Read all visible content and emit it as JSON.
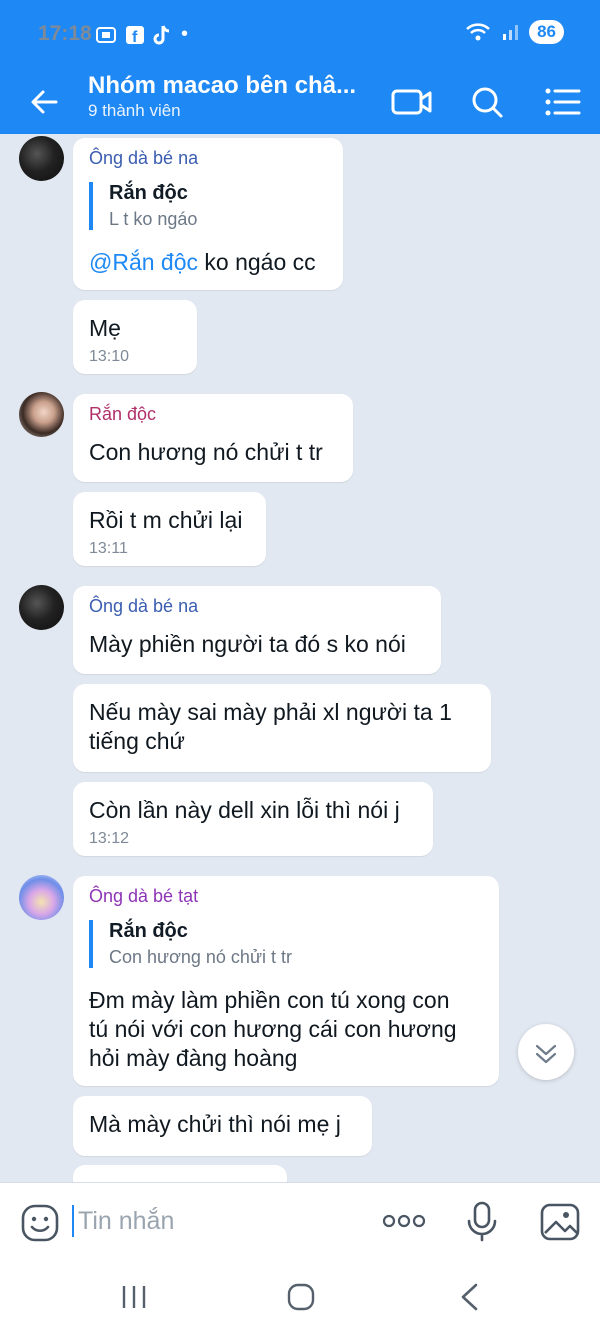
{
  "status": {
    "time": "17:18",
    "battery": "86"
  },
  "header": {
    "title": "Nhóm macao bên châ...",
    "subtitle": "9 thành viên"
  },
  "messages": {
    "m1": {
      "sender": "Ông dà bé na",
      "quote_name": "Rắn độc",
      "quote_text": "L t ko ngáo",
      "mention": "@Rắn độc",
      "text": " ko ngáo cc"
    },
    "m2": {
      "text": "Mẹ",
      "time": "13:10"
    },
    "m3": {
      "sender": "Rắn độc",
      "text": "Con hương nó chửi t tr"
    },
    "m4": {
      "text": "Rồi t m chửi lại",
      "time": "13:11"
    },
    "m5": {
      "sender": "Ông dà bé na",
      "text": "Mày phiền người ta đó s ko nói"
    },
    "m6": {
      "line1": "Nếu mày sai mày phải xl người ta 1",
      "line2": "tiếng chứ"
    },
    "m7": {
      "text": "Còn lần này dell xin lỗi thì nói j",
      "time": "13:12"
    },
    "m8": {
      "sender": "Ông dà bé tạt",
      "quote_name": "Rắn độc",
      "quote_text": "Con hương nó chửi t tr",
      "line1": "Đm mày làm phiền con tú xong con",
      "line2": "tú nói với con hương cái con hương",
      "line3": "hỏi mày đàng hoàng"
    },
    "m9": {
      "text": "Mà mày chửi thì nói mẹ j"
    }
  },
  "composer": {
    "placeholder": "Tin nhắn"
  },
  "colors": {
    "accent": "#1e88f5",
    "sender_na": "#3a5db0",
    "sender_rando": "#b0306a",
    "sender_tat": "#8e35b5"
  },
  "icons": [
    "back-icon",
    "video-call-icon",
    "search-icon",
    "menu-icon",
    "emoji-icon",
    "more-icon",
    "mic-icon",
    "image-icon",
    "chevron-down-icon"
  ]
}
